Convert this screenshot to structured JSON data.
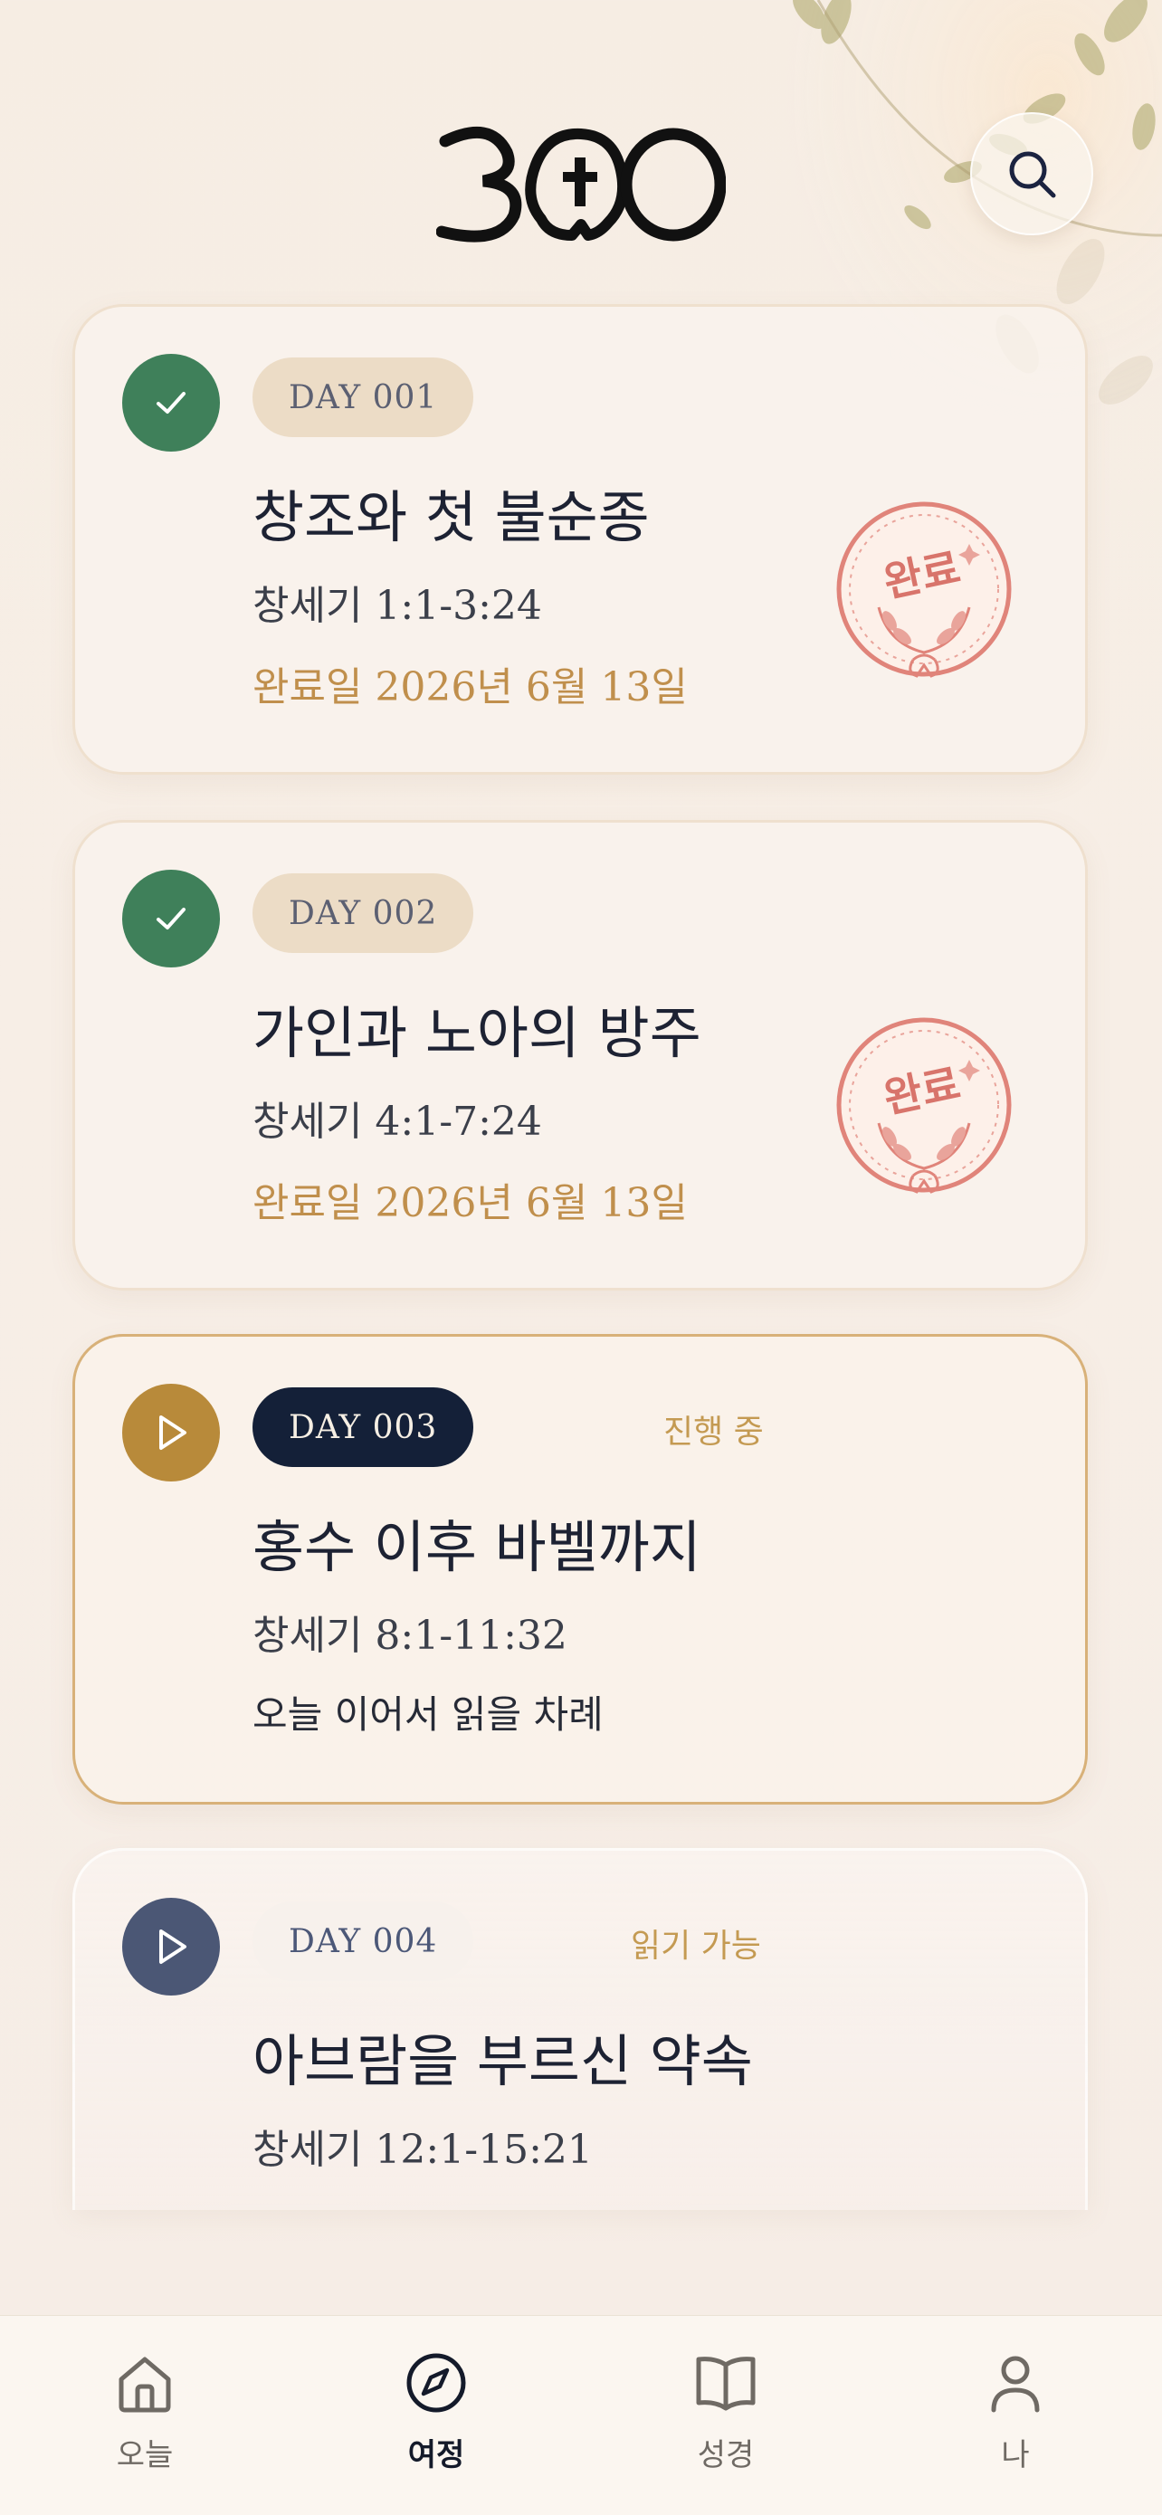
{
  "header": {
    "logo_text": "300",
    "search_icon": "search-icon"
  },
  "cards": [
    {
      "day": "DAY 001",
      "title": "창조와 첫 불순종",
      "ref": "창세기 1:1-3:24",
      "sub": "완료일 2026년 6월 13일",
      "state": "completed",
      "stamp": "완료"
    },
    {
      "day": "DAY 002",
      "title": "가인과 노아의 방주",
      "ref": "창세기 4:1-7:24",
      "sub": "완료일 2026년 6월 13일",
      "state": "completed",
      "stamp": "완료"
    },
    {
      "day": "DAY 003",
      "status": "진행 중",
      "title": "홍수 이후 바벨까지",
      "ref": "창세기 8:1-11:32",
      "sub": "오늘 이어서 읽을 차례",
      "state": "in-progress"
    },
    {
      "day": "DAY 004",
      "status": "읽기 가능",
      "title": "아브람을 부르신 약속",
      "ref": "창세기 12:1-15:21",
      "state": "available"
    }
  ],
  "colors": {
    "completed": "#3f805a",
    "in_progress": "#b88a3a",
    "available": "#4b5775",
    "accent": "#c49a52",
    "stamp": "#e0847a"
  },
  "tabbar": {
    "items": [
      {
        "label": "오늘",
        "icon": "home-icon"
      },
      {
        "label": "여정",
        "icon": "compass-icon",
        "active": true
      },
      {
        "label": "성경",
        "icon": "book-icon"
      },
      {
        "label": "나",
        "icon": "person-icon"
      }
    ]
  }
}
